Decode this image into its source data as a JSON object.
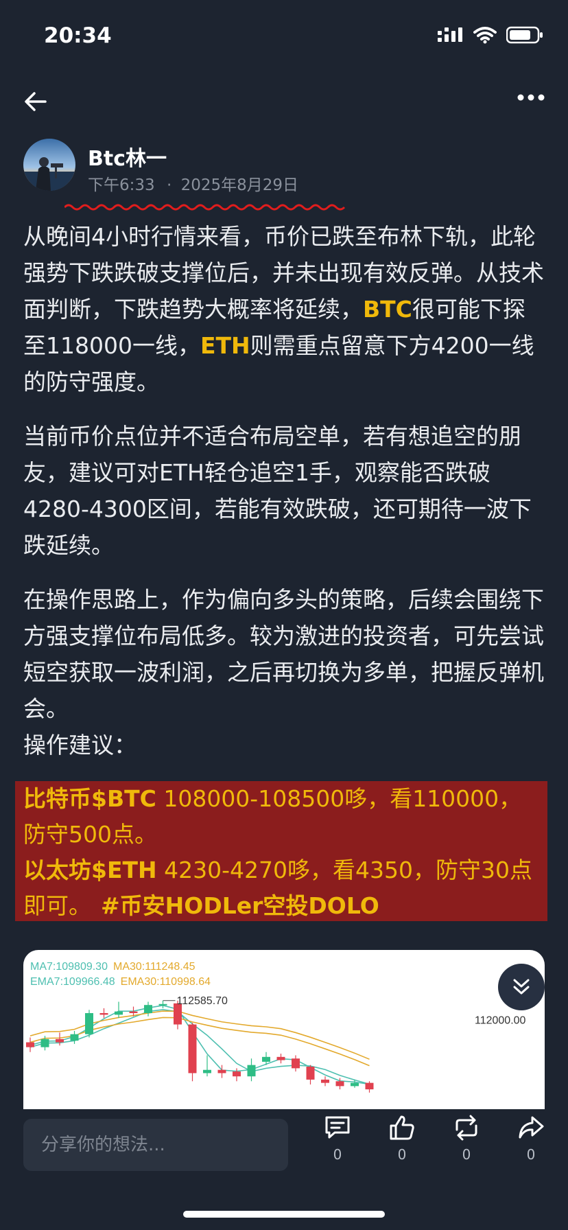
{
  "status_bar": {
    "time": "20:34"
  },
  "post": {
    "author": {
      "name": "Btc林一",
      "time": "下午6:33",
      "date": "2025年8月29日",
      "separator": "·"
    },
    "paragraphs": {
      "p1": {
        "line_a": "从晚间4小时行情来看，币价已跌至布林下轨，此轮强势下跌跌破支撑位后，并未出现有效反弹。从技术面判断，下跌趋势大概率将延续，",
        "btc": "BTC",
        "line_b": "很可能下探至118000一线，",
        "eth": "ETH",
        "line_c": "则需重点留意下方4200一线的防守强度。"
      },
      "p2": "当前币价点位并不适合布局空单，若有想追空的朋友，建议可对ETH轻仓追空1手，观察能否跌破4280-4300区间，若能有效跌破，还可期待一波下跌延续。",
      "p3": "在操作思路上，作为偏向多头的策略，后续会围绕下方强支撑位布局低多。较为激进的投资者，可先尝试短空获取一波利润，之后再切换为多单，把握反弹机会。",
      "p4": "操作建议："
    },
    "highlight": {
      "btc_name": "比特币",
      "btc_tag": "$BTC",
      "btc_text": " 108000-108500哆，看110000，防守500点。",
      "eth_name": "以太坊",
      "eth_tag": "$ETH",
      "eth_text": " 4230-4270哆，看4350，防守30点即可。",
      "hashtag": "#币安HODLer空投DOLO"
    }
  },
  "chart_data": {
    "type": "candlestick",
    "indicators": {
      "ma7": "MA7:109809.30",
      "ma30": "MA30:111248.45",
      "ema7": "EMA7:109966.48",
      "ema30": "EMA30:110998.64"
    },
    "price_label": "112000.00",
    "high_label": "112585.70",
    "ylim": [
      107800,
      113300
    ],
    "candles": [
      {
        "o": 111300,
        "c": 111150,
        "h": 111450,
        "l": 111000
      },
      {
        "o": 111150,
        "c": 111400,
        "h": 111500,
        "l": 111050
      },
      {
        "o": 111400,
        "c": 111300,
        "h": 111600,
        "l": 111200
      },
      {
        "o": 111350,
        "c": 111550,
        "h": 111650,
        "l": 111250
      },
      {
        "o": 111550,
        "c": 112200,
        "h": 112300,
        "l": 111450
      },
      {
        "o": 112200,
        "c": 112150,
        "h": 112350,
        "l": 112050
      },
      {
        "o": 112150,
        "c": 112250,
        "h": 112550,
        "l": 112050
      },
      {
        "o": 112250,
        "c": 112200,
        "h": 112400,
        "l": 112100
      },
      {
        "o": 112200,
        "c": 112450,
        "h": 112550,
        "l": 112100
      },
      {
        "o": 112450,
        "c": 112480,
        "h": 112585,
        "l": 112350
      },
      {
        "o": 112500,
        "c": 111850,
        "h": 112585,
        "l": 111700
      },
      {
        "o": 111850,
        "c": 110350,
        "h": 111900,
        "l": 110100
      },
      {
        "o": 110350,
        "c": 110450,
        "h": 110900,
        "l": 110250
      },
      {
        "o": 110450,
        "c": 110350,
        "h": 110600,
        "l": 110200
      },
      {
        "o": 110400,
        "c": 110250,
        "h": 110500,
        "l": 110100
      },
      {
        "o": 110250,
        "c": 110600,
        "h": 110800,
        "l": 110100
      },
      {
        "o": 110700,
        "c": 110850,
        "h": 111000,
        "l": 110600
      },
      {
        "o": 110850,
        "c": 110750,
        "h": 110950,
        "l": 110650
      },
      {
        "o": 110800,
        "c": 110500,
        "h": 110900,
        "l": 110400
      },
      {
        "o": 110550,
        "c": 110150,
        "h": 110600,
        "l": 110000
      },
      {
        "o": 110150,
        "c": 110050,
        "h": 110250,
        "l": 109950
      },
      {
        "o": 110100,
        "c": 109950,
        "h": 110200,
        "l": 109850
      },
      {
        "o": 109950,
        "c": 110050,
        "h": 110150,
        "l": 109900
      },
      {
        "o": 110050,
        "c": 109850,
        "h": 110100,
        "l": 109750
      }
    ]
  },
  "scroll_icon": "chevron-double-down-icon",
  "bottom_bar": {
    "comment_placeholder": "分享你的想法...",
    "comments": "0",
    "likes": "0",
    "reposts": "0",
    "shares": "0"
  }
}
